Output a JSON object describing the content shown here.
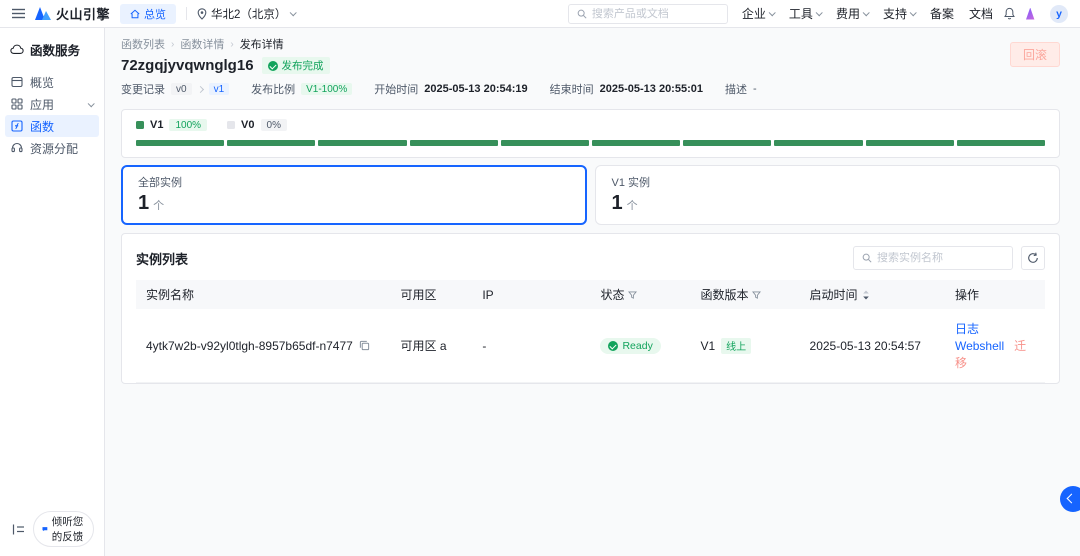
{
  "topbar": {
    "logo_text": "火山引擎",
    "overview_label": "总览",
    "region_label": "华北2（北京）",
    "search_placeholder": "搜索产品或文档",
    "menus": [
      {
        "label": "企业"
      },
      {
        "label": "工具"
      },
      {
        "label": "费用"
      },
      {
        "label": "支持"
      },
      {
        "label": "备案"
      },
      {
        "label": "文档"
      }
    ],
    "avatar_text": "y"
  },
  "sidebar": {
    "title": "函数服务",
    "items": [
      {
        "label": "概览"
      },
      {
        "label": "应用"
      },
      {
        "label": "函数"
      },
      {
        "label": "资源分配"
      }
    ],
    "feedback_label": "倾听您的反馈"
  },
  "page": {
    "breadcrumb": [
      "函数列表",
      "函数详情",
      "发布详情"
    ],
    "title": "72zgqjyvqwnglg16",
    "status_badge": "发布完成",
    "rollback_label": "回滚",
    "meta": {
      "change_label": "变更记录",
      "from_version": "v0",
      "to_version": "v1",
      "ratio_label": "发布比例",
      "ratio_value": "V1-100%",
      "start_label": "开始时间",
      "start_value": "2025-05-13 20:54:19",
      "end_label": "结束时间",
      "end_value": "2025-05-13 20:55:01",
      "desc_label": "描述",
      "desc_value": "-"
    }
  },
  "traffic": {
    "segments": 10,
    "legend": [
      {
        "name": "V1",
        "value": "100%"
      },
      {
        "name": "V0",
        "value": "0%"
      }
    ]
  },
  "stats": [
    {
      "label": "全部实例",
      "value": "1",
      "unit": "个"
    },
    {
      "label": "V1 实例",
      "value": "1",
      "unit": "个"
    }
  ],
  "instances": {
    "title": "实例列表",
    "search_placeholder": "搜索实例名称",
    "columns": [
      "实例名称",
      "可用区",
      "IP",
      "状态",
      "函数版本",
      "启动时间",
      "操作"
    ],
    "rows": [
      {
        "name": "4ytk7w2b-v92yl0tlgh-8957b65df-n7477",
        "zone": "可用区 a",
        "ip": "-",
        "status": "Ready",
        "version": "V1",
        "version_tag": "线上",
        "started": "2025-05-13 20:54:57",
        "actions": [
          "日志",
          "Webshell",
          "迁移"
        ]
      }
    ]
  },
  "colors": {
    "primary": "#1664ff",
    "primary-light": "#eaf2ff",
    "success": "#12a35c",
    "success-light": "#e8f8ee",
    "bar-green": "#37905a",
    "danger-light-bg": "#ffece8",
    "danger-light-text": "#fba79d",
    "danger-link": "#f7918a",
    "text-dark": "#1d2129",
    "text-mid": "#4e5969",
    "text-gray": "#86909c",
    "border": "#e5e6eb",
    "bg-page": "#f9fafb",
    "bg-gray": "#f2f3f5"
  }
}
